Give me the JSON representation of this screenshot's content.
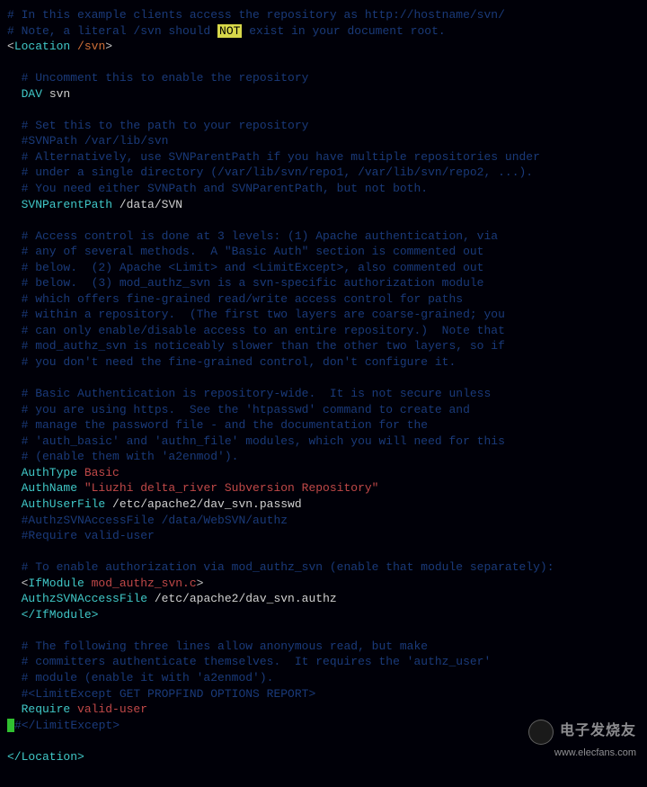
{
  "lines": {
    "c1": "# In this example clients access the repository as http://hostname/svn/",
    "c2a": "# Note, a literal /svn should ",
    "c2highlight": "NOT",
    "c2b": " exist in your document root.",
    "loc_open_a": "<",
    "loc_open_b": "Location",
    "loc_open_c": " /svn",
    "loc_open_d": ">",
    "c3": "  # Uncomment this to enable the repository",
    "dav_k": "  DAV",
    "dav_v": " svn",
    "c4": "  # Set this to the path to your repository",
    "c5": "  #SVNPath /var/lib/svn",
    "c6": "  # Alternatively, use SVNParentPath if you have multiple repositories under",
    "c7": "  # under a single directory (/var/lib/svn/repo1, /var/lib/svn/repo2, ...).",
    "c8": "  # You need either SVNPath and SVNParentPath, but not both.",
    "svnpp_k": "  SVNParentPath",
    "svnpp_v": " /data/SVN",
    "c9": "  # Access control is done at 3 levels: (1) Apache authentication, via",
    "c10": "  # any of several methods.  A \"Basic Auth\" section is commented out",
    "c11": "  # below.  (2) Apache <Limit> and <LimitExcept>, also commented out",
    "c12": "  # below.  (3) mod_authz_svn is a svn-specific authorization module",
    "c13": "  # which offers fine-grained read/write access control for paths",
    "c14": "  # within a repository.  (The first two layers are coarse-grained; you",
    "c15": "  # can only enable/disable access to an entire repository.)  Note that",
    "c16": "  # mod_authz_svn is noticeably slower than the other two layers, so if",
    "c17": "  # you don't need the fine-grained control, don't configure it.",
    "c18": "  # Basic Authentication is repository-wide.  It is not secure unless",
    "c19": "  # you are using https.  See the 'htpasswd' command to create and",
    "c20": "  # manage the password file - and the documentation for the",
    "c21": "  # 'auth_basic' and 'authn_file' modules, which you will need for this",
    "c22": "  # (enable them with 'a2enmod').",
    "authtype_k": "  AuthType",
    "authtype_v": " Basic",
    "authname_k": "  AuthName",
    "authname_v": " \"Liuzhi delta_river Subversion Repository\"",
    "authuf_k": "  AuthUserFile",
    "authuf_v": " /etc/apache2/dav_svn.passwd",
    "c23": "  #AuthzSVNAccessFile /data/WebSVN/authz",
    "c24": "  #Require valid-user",
    "c25": "  # To enable authorization via mod_authz_svn (enable that module separately):",
    "ifmod_a": "  <",
    "ifmod_b": "IfModule",
    "ifmod_c": " mod_authz_svn.c",
    "ifmod_d": ">",
    "authzaf_k": "  AuthzSVNAccessFile",
    "authzaf_v": " /etc/apache2/dav_svn.authz",
    "ifmod_close": "  </IfModule>",
    "c26": "  # The following three lines allow anonymous read, but make",
    "c27": "  # committers authenticate themselves.  It requires the 'authz_user'",
    "c28": "  # module (enable it with 'a2enmod').",
    "c29": "  #<LimitExcept GET PROPFIND OPTIONS REPORT>",
    "require_k": "  Require",
    "require_v": " valid-user",
    "c30": "#</LimitExcept>",
    "loc_close": "</Location>"
  },
  "watermark": {
    "brand": "电子发烧友",
    "url": "www.elecfans.com"
  }
}
